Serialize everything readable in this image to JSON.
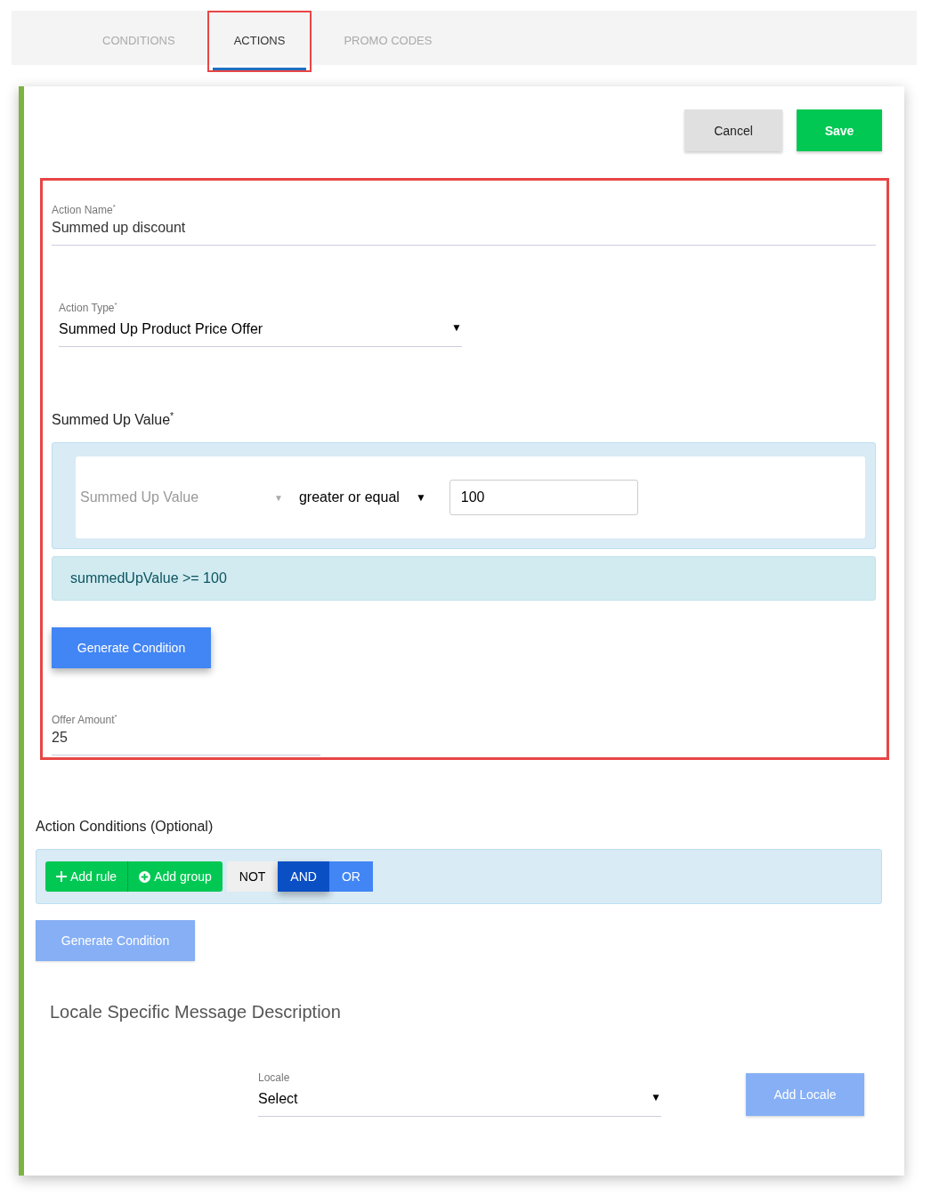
{
  "tabs": [
    {
      "label": "CONDITIONS",
      "selected": false
    },
    {
      "label": "ACTIONS",
      "selected": true
    },
    {
      "label": "PROMO CODES",
      "selected": false
    }
  ],
  "header_buttons": [
    {
      "label": "Cancel",
      "kind": "secondary"
    },
    {
      "label": "Save",
      "kind": "primary"
    }
  ],
  "action_name": {
    "label": "Action Name$^{*}$",
    "value": "Summed up discount"
  },
  "action_type": {
    "label": "Action Type$^{*}$",
    "value": "Summed Up Product Price Offer",
    "caret": "▼"
  },
  "summed_up_value": {
    "heading": "Summed Up Value$^{*}$",
    "field": "Summed Up Value",
    "field_caret": "▼",
    "operator": "greater or equal",
    "operator_caret": "▼",
    "value": "100",
    "expression": "summedUpValue >= 100",
    "button": {
      "label": "Generate Condition",
      "disabled": false
    }
  },
  "offer_amount": {
    "label": "Offer Amount$^{*}$",
    "value": "25"
  },
  "action_conditions": {
    "heading": "Action Conditions (Optional)",
    "add_buttons": [
      {
        "label": "Add rule",
        "kind": "plus"
      },
      {
        "label": "Add group",
        "kind": "circle-plus"
      }
    ],
    "combinators": [
      {
        "label": "NOT",
        "selected": false,
        "kind": "not"
      },
      {
        "label": "AND",
        "selected": true,
        "kind": "join"
      },
      {
        "label": "OR",
        "selected": false,
        "kind": "join"
      }
    ],
    "button": {
      "label": "Generate Condition",
      "disabled": true
    }
  },
  "locale_section": {
    "heading": "Locale Specific Message Description",
    "label": "Locale",
    "value": "Select",
    "caret": "▼",
    "button": {
      "label": "Add Locale",
      "disabled": true
    }
  }
}
